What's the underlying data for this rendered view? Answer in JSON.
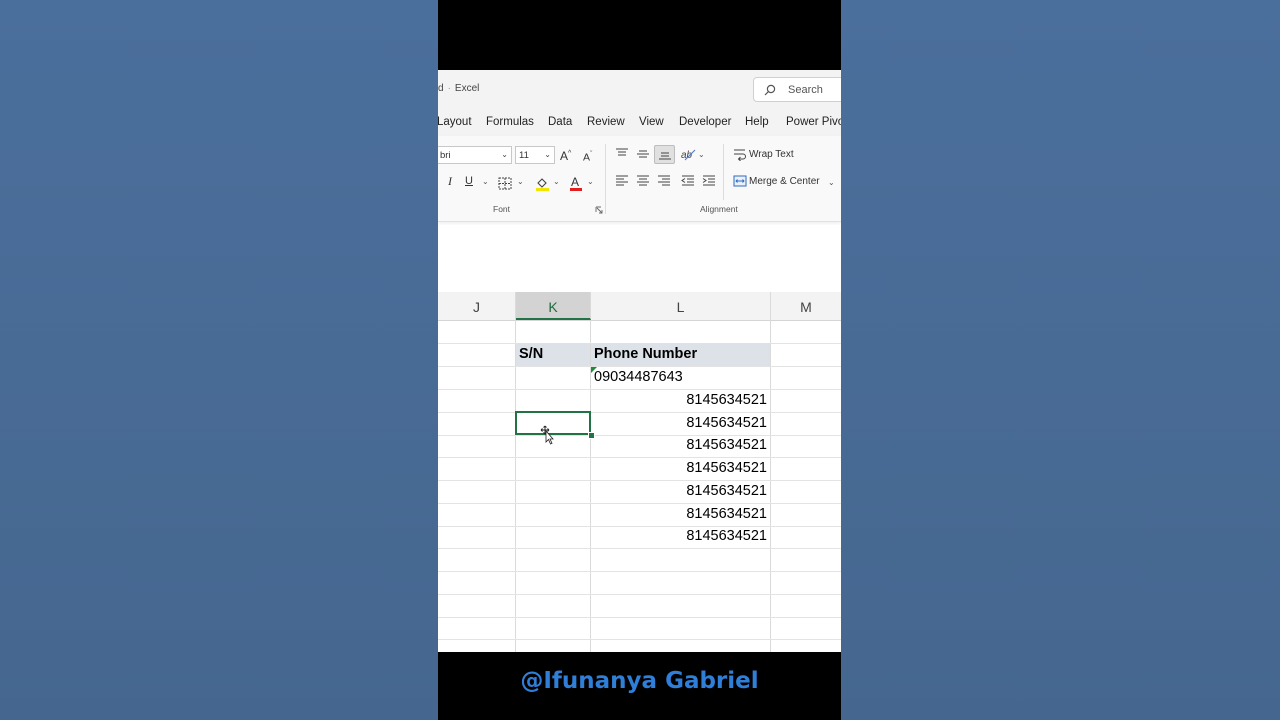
{
  "window": {
    "title_prefix": "d",
    "app_name": "Excel",
    "search_placeholder": "Search"
  },
  "menu": [
    "Layout",
    "Formulas",
    "Data",
    "Review",
    "View",
    "Developer",
    "Help",
    "Power Pivo"
  ],
  "ribbon": {
    "font_name": "bri",
    "font_size": "11",
    "font_group_label": "Font",
    "alignment_group_label": "Alignment",
    "wrap_text_label": "Wrap Text",
    "merge_center_label": "Merge & Center",
    "italic": "I",
    "underline": "U"
  },
  "sheet": {
    "columns": [
      "J",
      "K",
      "L",
      "M"
    ],
    "active_column": "K",
    "header_sn": "S/N",
    "header_phone": "Phone Number",
    "first_value": "09034487643",
    "values": [
      "8145634521",
      "8145634521",
      "8145634521",
      "8145634521",
      "8145634521",
      "8145634521",
      "8145634521"
    ]
  },
  "watermark": "@Ifunanya Gabriel",
  "colors": {
    "accent": "#217346",
    "watermark": "#2f7fd8",
    "background": "#4a6d99"
  }
}
